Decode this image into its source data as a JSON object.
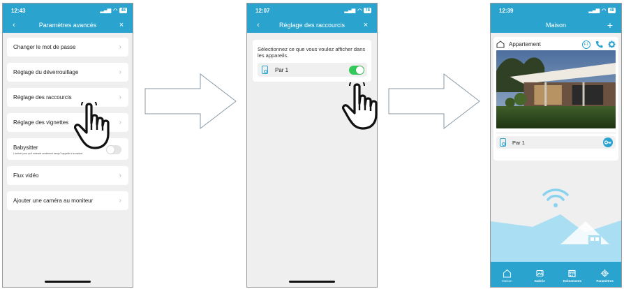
{
  "colors": {
    "accent": "#2aa3cf",
    "toggle_on": "#34c759",
    "toggle_off": "#e4e4e4",
    "background": "#efefef"
  },
  "screen1": {
    "time": "12:43",
    "battery": "48",
    "nav_title": "Paramètres avancés",
    "items": [
      {
        "label": "Changer le mot de passe"
      },
      {
        "label": "Réglage du déverrouillage"
      },
      {
        "label": "Réglage des raccourcis"
      },
      {
        "label": "Réglage des vignettes"
      }
    ],
    "babysitter": {
      "label": "Babysitter",
      "description": "L'activer pour qu'il entende seulement lorsqu'il appelle à la maison",
      "enabled": false
    },
    "items2": [
      {
        "label": "Flux vidéo"
      },
      {
        "label": "Ajouter une caméra au moniteur"
      }
    ]
  },
  "screen2": {
    "time": "12:07",
    "battery": "78",
    "nav_title": "Réglage des raccourcis",
    "prompt": "Sélectionnez ce que vous voulez afficher dans les appareils.",
    "device": {
      "label": "Par 1",
      "enabled": true
    }
  },
  "screen3": {
    "time": "12:39",
    "battery": "48",
    "nav_title": "Maison",
    "card_title": "Appartement",
    "f1_label": "F1",
    "device_label": "Par 1",
    "tabs": [
      {
        "label": "Maison",
        "icon": "home-icon"
      },
      {
        "label": "Galerie",
        "icon": "gallery-icon"
      },
      {
        "label": "Evènements",
        "icon": "calendar-icon"
      },
      {
        "label": "Paramètres",
        "icon": "gear-icon"
      }
    ]
  },
  "icons": {
    "back": "‹",
    "close": "×",
    "add": "+",
    "chevron": "›"
  }
}
